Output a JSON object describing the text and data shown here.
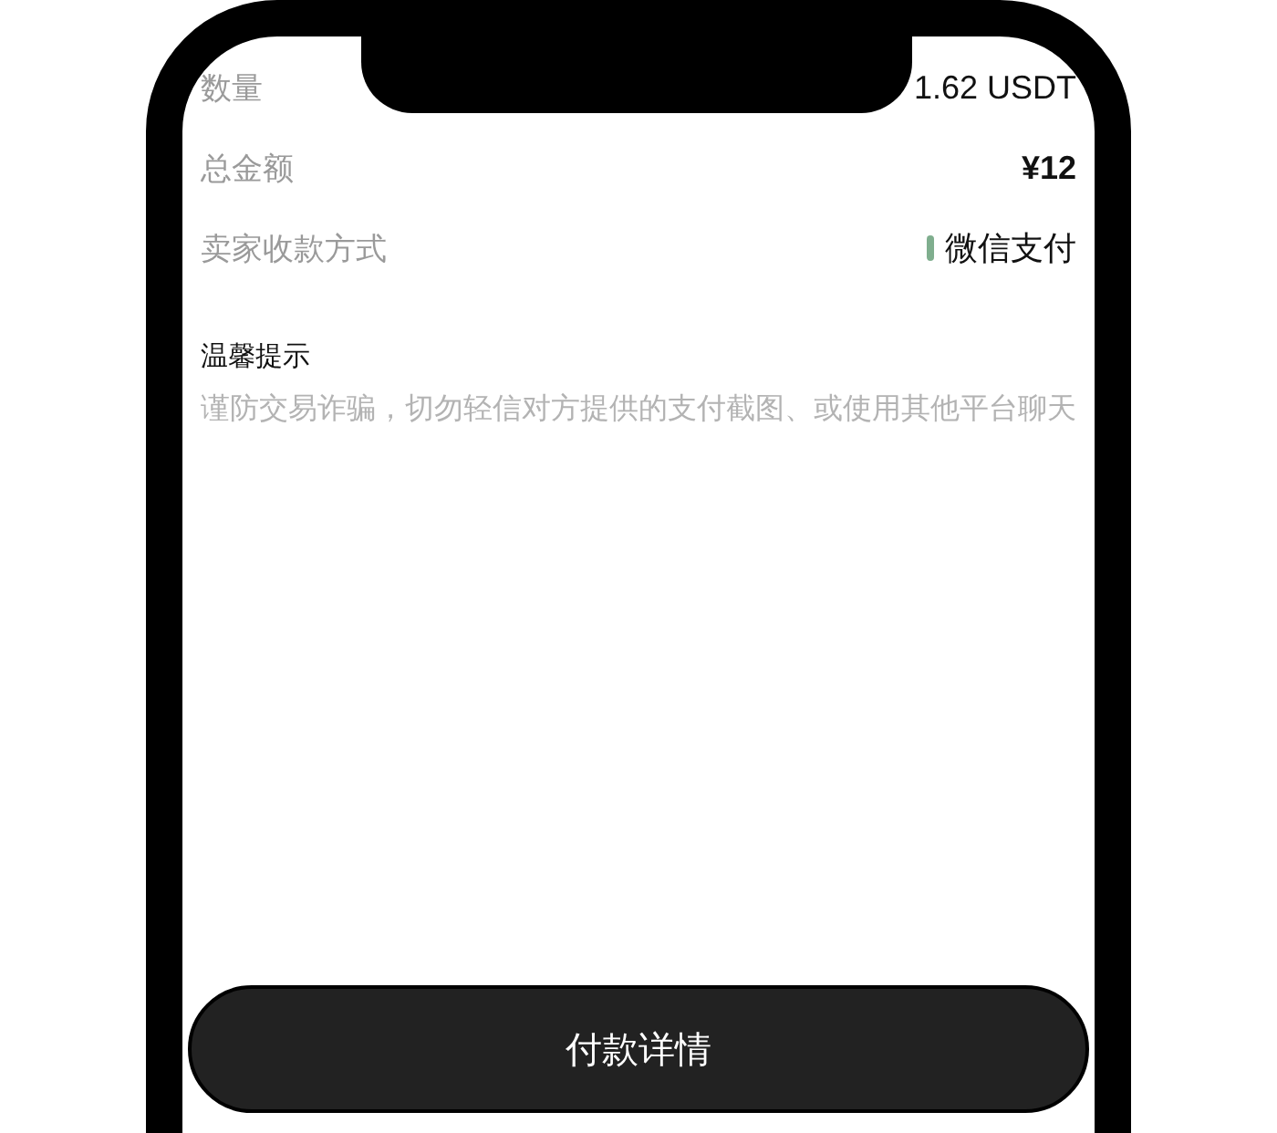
{
  "details": [
    {
      "label": "数量",
      "value": "1.62 USDT",
      "kind": "plain"
    },
    {
      "label": "总金额",
      "value": "¥12",
      "kind": "bold"
    },
    {
      "label": "卖家收款方式",
      "value": "微信支付",
      "kind": "payment"
    }
  ],
  "notice": {
    "title": "温馨提示",
    "text": "谨防交易诈骗，切勿轻信对方提供的支付截图、或使用其他平台聊天"
  },
  "button": {
    "label": "付款详情"
  }
}
